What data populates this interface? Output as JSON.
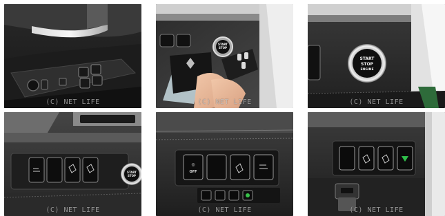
{
  "gallery": {
    "watermark": "(C) NET LIFE",
    "start_button": {
      "line1": "START",
      "line2": "STOP",
      "line3": "ENGINE"
    },
    "off_label": "OFF",
    "tiles": [
      {
        "id": "door-window-switch-panel"
      },
      {
        "id": "keyfob-and-start-button"
      },
      {
        "id": "start-stop-button-closeup"
      },
      {
        "id": "left-dash-switch-panel"
      },
      {
        "id": "lower-dash-switch-row"
      },
      {
        "id": "right-lower-dash-switches"
      }
    ]
  }
}
